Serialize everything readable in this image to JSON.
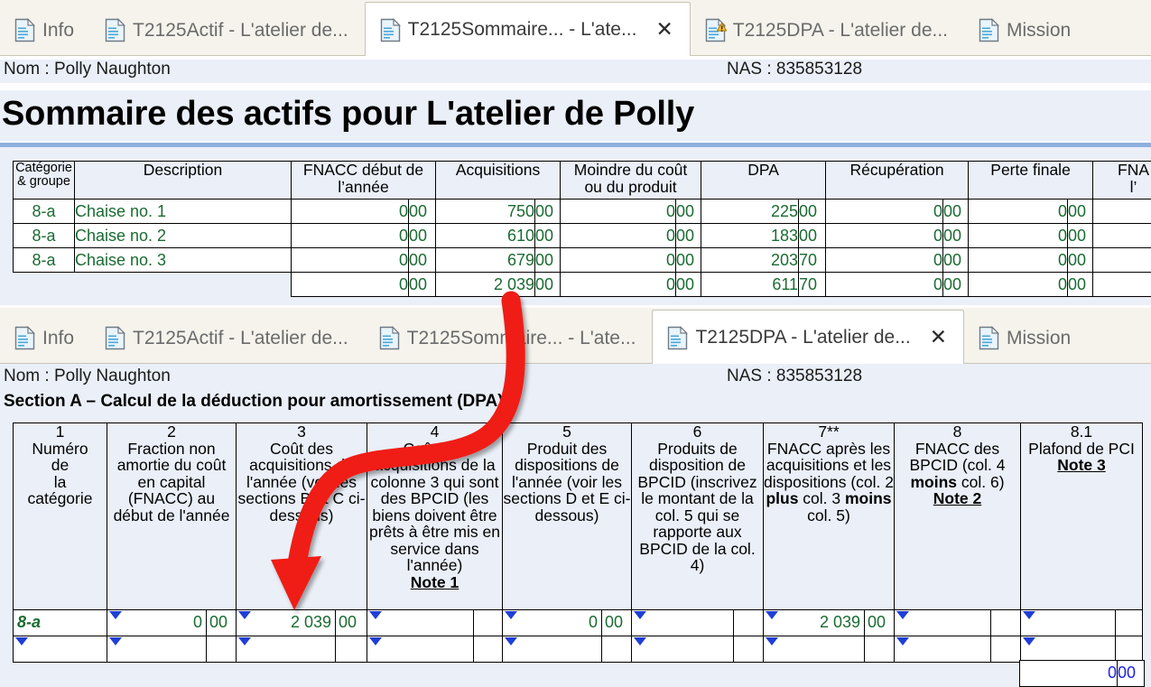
{
  "window_top": {
    "tabs": [
      {
        "label": "Info",
        "icon": "document-icon",
        "active": false,
        "closable": false,
        "warning": false
      },
      {
        "label": "T2125Actif - L'atelier de...",
        "icon": "document-icon",
        "active": false,
        "closable": false,
        "warning": false
      },
      {
        "label": "T2125Sommaire... - L'ate...",
        "icon": "document-icon",
        "active": true,
        "closable": true,
        "warning": false
      },
      {
        "label": "T2125DPA - L'atelier de...",
        "icon": "document-warning-icon",
        "active": false,
        "closable": false,
        "warning": true
      },
      {
        "label": "Mission",
        "icon": "document-icon",
        "active": false,
        "closable": false,
        "warning": false
      }
    ],
    "close_glyph": "✕",
    "name_label": "Nom : Polly Naughton",
    "nas_label": "NAS : 835853128",
    "title": "Sommaire des actifs pour L'atelier de Polly",
    "table": {
      "headers": [
        "Catégorie\n& groupe",
        "Description",
        "FNACC début de l’année",
        "Acquisitions",
        "Moindre du coût ou du produit",
        "DPA",
        "Récupération",
        "Perte finale",
        "FNACC à la fin de l’année"
      ],
      "headers_short": [
        "Catégorie",
        "& groupe",
        "Description",
        "FNACC début de",
        "l’année",
        "Acquisitions",
        "Moindre du coût",
        "ou du produit",
        "DPA",
        "Récupération",
        "Perte finale",
        "FNA",
        "l’"
      ],
      "rows": [
        {
          "categorie": "8-a",
          "description": "Chaise no. 1",
          "fnacc_debut": "0",
          "fnacc_debut_c": "00",
          "acquisitions": "750",
          "acquisitions_c": "00",
          "moindre": "0",
          "moindre_c": "00",
          "dpa": "225",
          "dpa_c": "00",
          "recuperation": "0",
          "recuperation_c": "00",
          "perte_finale": "0",
          "perte_finale_c": "00",
          "fnacc_fin": "",
          "fnacc_fin_c": ""
        },
        {
          "categorie": "8-a",
          "description": "Chaise no. 2",
          "fnacc_debut": "0",
          "fnacc_debut_c": "00",
          "acquisitions": "610",
          "acquisitions_c": "00",
          "moindre": "0",
          "moindre_c": "00",
          "dpa": "183",
          "dpa_c": "00",
          "recuperation": "0",
          "recuperation_c": "00",
          "perte_finale": "0",
          "perte_finale_c": "00",
          "fnacc_fin": "",
          "fnacc_fin_c": ""
        },
        {
          "categorie": "8-a",
          "description": "Chaise no. 3",
          "fnacc_debut": "0",
          "fnacc_debut_c": "00",
          "acquisitions": "679",
          "acquisitions_c": "00",
          "moindre": "0",
          "moindre_c": "00",
          "dpa": "203",
          "dpa_c": "70",
          "recuperation": "0",
          "recuperation_c": "00",
          "perte_finale": "0",
          "perte_finale_c": "00",
          "fnacc_fin": "",
          "fnacc_fin_c": ""
        }
      ],
      "total_row": {
        "categorie": "",
        "description": "",
        "fnacc_debut": "0",
        "fnacc_debut_c": "00",
        "acquisitions": "2 039",
        "acquisitions_c": "00",
        "moindre": "0",
        "moindre_c": "00",
        "dpa": "611",
        "dpa_c": "70",
        "recuperation": "0",
        "recuperation_c": "00",
        "perte_finale": "0",
        "perte_finale_c": "00",
        "fnacc_fin": "",
        "fnacc_fin_c": ""
      }
    }
  },
  "window_bottom": {
    "tabs": [
      {
        "label": "Info",
        "icon": "document-icon",
        "active": false,
        "closable": false
      },
      {
        "label": "T2125Actif - L'atelier de...",
        "icon": "document-icon",
        "active": false,
        "closable": false
      },
      {
        "label": "T2125Sommaire... - L'ate...",
        "icon": "document-icon",
        "active": false,
        "closable": false
      },
      {
        "label": "T2125DPA - L'atelier de...",
        "icon": "document-icon",
        "active": true,
        "closable": true
      },
      {
        "label": "Mission",
        "icon": "document-icon",
        "active": false,
        "closable": false
      }
    ],
    "close_glyph": "✕",
    "name_label": "Nom : Polly Naughton",
    "nas_label": "NAS : 835853128",
    "section_title": "Section A – Calcul de la déduction pour amortissement (DPA)",
    "table": {
      "columns": [
        {
          "num": "1",
          "title": "Numéro de la catégorie"
        },
        {
          "num": "2",
          "title": "Fraction non amortie du coût en capital (FNACC) au début de l'année"
        },
        {
          "num": "3",
          "title": "Coût des acquisitions de l'année (voir les sections B et C ci-dessous)"
        },
        {
          "num": "4",
          "title": "Coût des acquisitions de la colonne 3 qui sont des BPCID (les biens doivent être prêts à être mis en service dans l'année)",
          "note": "Note 1"
        },
        {
          "num": "5",
          "title": "Produit des dispositions de l'année (voir les sections D et E ci-dessous)"
        },
        {
          "num": "6",
          "title": "Produits de disposition de BPCID (inscrivez le montant de la col. 5 qui se rapporte aux BPCID de la col. 4)"
        },
        {
          "num": "7**",
          "title": "FNACC après les acquisitions et les dispositions (col. 2 plus col. 3 moins col. 5)"
        },
        {
          "num": "8",
          "title": "FNACC des BPCID (col. 4 moins col. 6)",
          "note": "Note 2"
        },
        {
          "num": "8.1",
          "title": "Plafond de PCI",
          "note": "Note 3"
        }
      ],
      "rows": [
        {
          "col1": "8-a",
          "col2": "0",
          "col2_c": "00",
          "col3": "2 039",
          "col3_c": "00",
          "col4": "",
          "col4_c": "",
          "col5": "0",
          "col5_c": "00",
          "col6": "",
          "col6_c": "",
          "col7": "2 039",
          "col7_c": "00",
          "col8": "",
          "col8_c": "",
          "col81": "",
          "col81_c": ""
        },
        {
          "col1": "",
          "col2": "",
          "col2_c": "",
          "col3": "",
          "col3_c": "",
          "col4": "",
          "col4_c": "",
          "col5": "",
          "col5_c": "",
          "col6": "",
          "col6_c": "",
          "col7": "",
          "col7_c": "",
          "col8": "",
          "col8_c": "",
          "col81": "",
          "col81_c": ""
        }
      ],
      "footer_total": {
        "value": "0",
        "cents": "00"
      }
    }
  },
  "annotation": {
    "type": "red-curved-arrow",
    "color": "#F01C12",
    "from": "top window acquisitions total (2 039)",
    "to": "bottom window column 3 header"
  },
  "colors": {
    "tabstrip_bg": "#f5f3ec",
    "active_tab_bg": "#ffffff",
    "panel_bg": "#eaeff8",
    "rule_blue": "#8fb0dd",
    "value_green": "#1b6b32",
    "value_blue": "#1e22e6",
    "arrow_red": "#F01C12",
    "warning_yellow": "#FFC83D"
  }
}
